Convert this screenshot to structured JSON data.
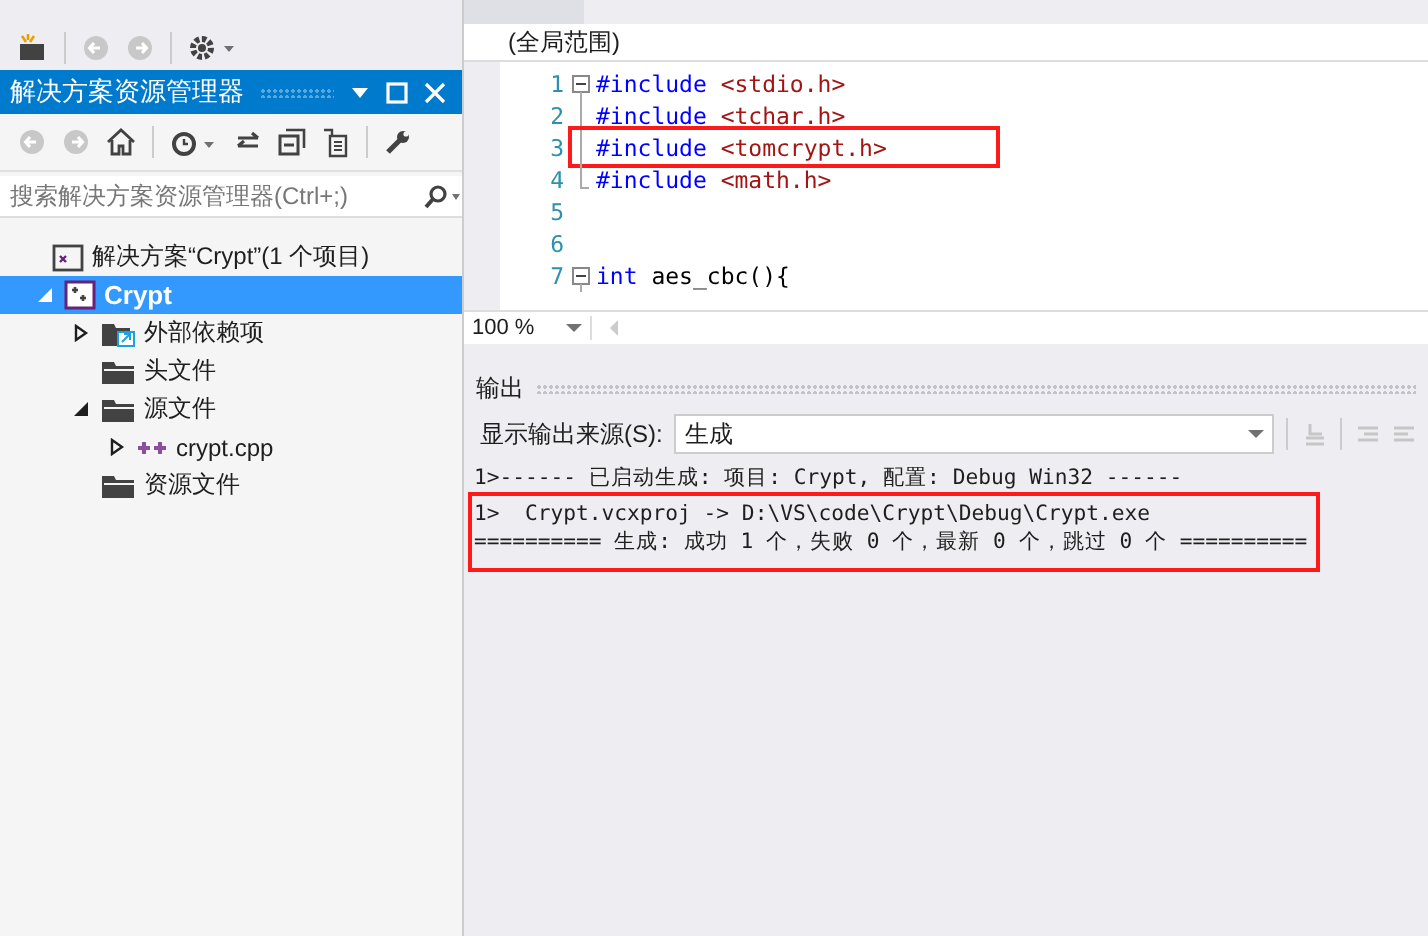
{
  "solution_explorer": {
    "title": "解决方案资源管理器",
    "search": {
      "placeholder": "搜索解决方案资源管理器(Ctrl+;)"
    },
    "tree": [
      {
        "label": "解决方案“Crypt”(1 个项目)",
        "kind": "solution",
        "selected": false,
        "children": [
          {
            "label": "Crypt",
            "kind": "project",
            "selected": true,
            "expanded": true,
            "children": [
              {
                "label": "外部依赖项",
                "kind": "dependencies",
                "selected": false,
                "expanded": false
              },
              {
                "label": "头文件",
                "kind": "folder",
                "selected": false
              },
              {
                "label": "源文件",
                "kind": "folder",
                "selected": false,
                "expanded": true,
                "children": [
                  {
                    "label": "crypt.cpp",
                    "kind": "cpp",
                    "selected": false,
                    "expanded": false
                  }
                ]
              },
              {
                "label": "资源文件",
                "kind": "folder",
                "selected": false
              }
            ]
          }
        ]
      }
    ]
  },
  "editor": {
    "scope": "(全局范围)",
    "zoom": "100 %",
    "lines": [
      {
        "number": "1",
        "kind": "fold_start",
        "highlighted": false,
        "tokens": [
          {
            "text": "#include",
            "kind": "keyword"
          },
          {
            "text": " <stdio.h>",
            "kind": "string"
          }
        ]
      },
      {
        "number": "2",
        "kind": "fold_line",
        "highlighted": false,
        "tokens": [
          {
            "text": "#include",
            "kind": "keyword"
          },
          {
            "text": " <tchar.h>",
            "kind": "string"
          }
        ]
      },
      {
        "number": "3",
        "kind": "fold_line",
        "highlighted": true,
        "tokens": [
          {
            "text": "#include",
            "kind": "keyword"
          },
          {
            "text": " <tomcrypt.h>",
            "kind": "string"
          }
        ]
      },
      {
        "number": "4",
        "kind": "fold_end",
        "highlighted": false,
        "tokens": [
          {
            "text": "#include",
            "kind": "keyword"
          },
          {
            "text": " <math.h>",
            "kind": "string"
          }
        ]
      },
      {
        "number": "5",
        "kind": "plain",
        "highlighted": false
      },
      {
        "number": "6",
        "kind": "plain",
        "highlighted": false
      },
      {
        "number": "7",
        "kind": "fold_start",
        "highlighted": false,
        "tokens": [
          {
            "text": "int",
            "kind": "keyword"
          },
          {
            "text": " aes_cbc(){",
            "kind": "plain"
          }
        ]
      }
    ]
  },
  "output": {
    "title": "输出",
    "source_label": "显示输出来源(S):",
    "source": "生成",
    "lines": [
      {
        "text": "1>------ 已启动生成: 项目: Crypt, 配置: Debug Win32 ------",
        "highlighted": false
      },
      {
        "text": "1>  Crypt.vcxproj -> D:\\VS\\code\\Crypt\\Debug\\Crypt.exe",
        "highlighted": true
      },
      {
        "text": "========== 生成: 成功 1 个，失败 0 个，最新 0 个，跳过 0 个 ==========",
        "highlighted": true
      }
    ]
  }
}
